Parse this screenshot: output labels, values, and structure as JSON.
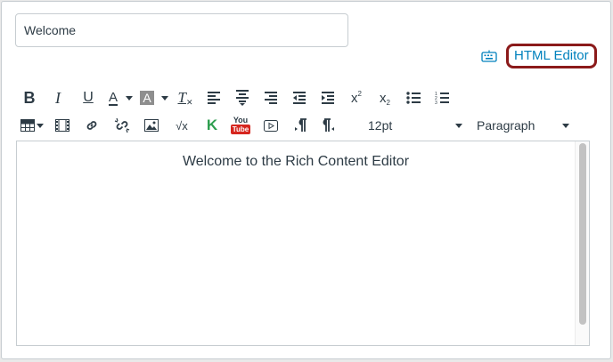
{
  "title_field": {
    "value": "Welcome"
  },
  "html_editor": {
    "label": "HTML Editor",
    "icon": "keyboard-icon",
    "highlight_color": "#8b1a1a",
    "link_color": "#0081bd"
  },
  "toolbar": {
    "row1": [
      "bold-icon",
      "italic-icon",
      "underline-icon",
      "text-color-icon",
      "background-color-icon",
      "clear-formatting-icon",
      "align-left-icon",
      "align-center-icon",
      "align-right-icon",
      "outdent-icon",
      "indent-icon",
      "superscript-icon",
      "subscript-icon",
      "bulleted-list-icon",
      "numbered-list-icon"
    ],
    "row2": [
      "table-icon",
      "media-icon",
      "link-icon",
      "unlink-icon",
      "image-icon",
      "math-equation-icon",
      "kaltura-icon",
      "youtube-icon",
      "record-media-icon",
      "ltr-icon",
      "rtl-icon"
    ],
    "bold_label": "B",
    "italic_label": "I",
    "underline_label": "U",
    "text_color_label": "A",
    "bg_color_label": "A",
    "clear_format_label": "T",
    "superscript_label": "x",
    "superscript_sup": "2",
    "subscript_label": "x",
    "subscript_sub": "2",
    "kaltura_label": "K",
    "youtube_top": "You",
    "youtube_bottom": "Tube",
    "math_label": "√x",
    "font_size": {
      "value": "12pt"
    },
    "block_format": {
      "value": "Paragraph"
    }
  },
  "editor": {
    "content": "Welcome to the Rich Content Editor"
  }
}
